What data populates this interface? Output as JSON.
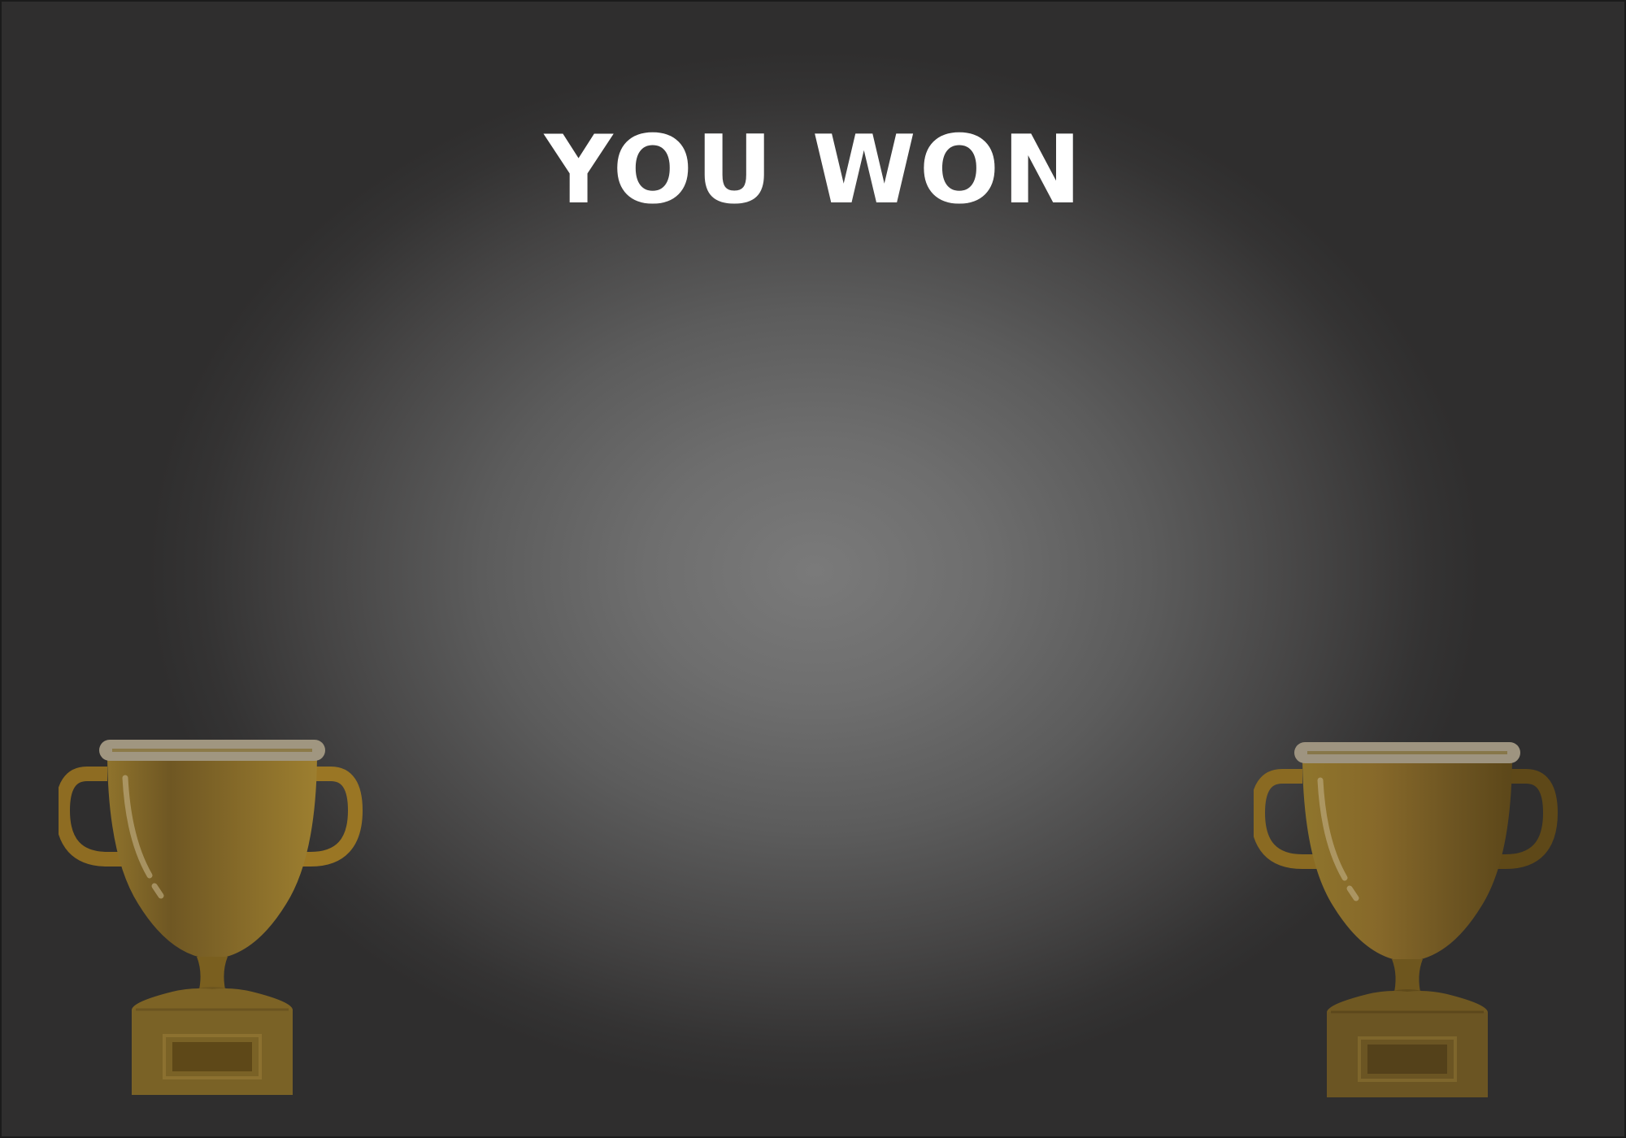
{
  "screen": {
    "title": "YOU WON"
  },
  "trophies": [
    {
      "icon": "trophy-icon",
      "position": "bottom-left"
    },
    {
      "icon": "trophy-icon",
      "position": "bottom-right"
    }
  ],
  "colors": {
    "title": "#ffffff",
    "trophy_gold": "#8a6e2a",
    "trophy_gold_light": "#9f8030",
    "trophy_dark": "#6a5320",
    "rim": "#a09680",
    "background_center": "#7a7a7a",
    "background_edge": "#2f2e2e"
  }
}
